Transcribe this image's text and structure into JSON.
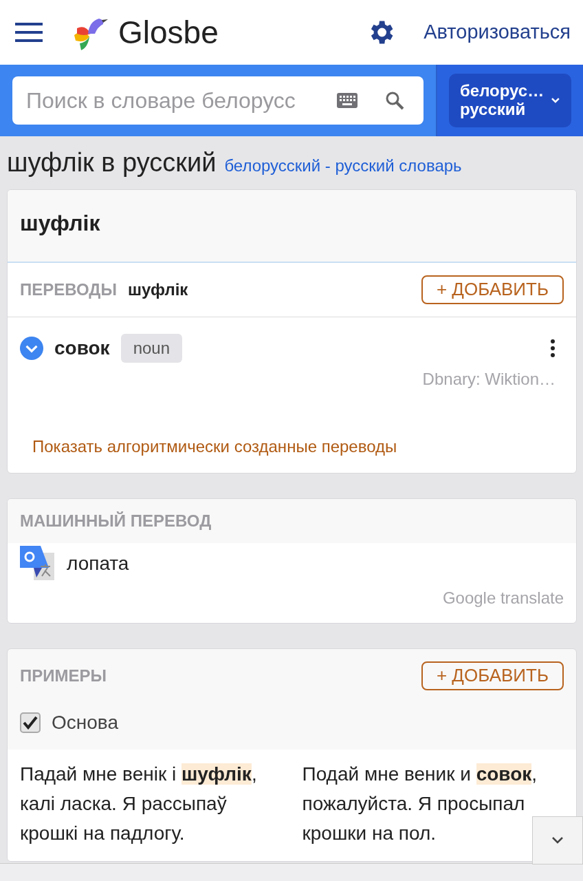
{
  "header": {
    "logo_text": "Glosbe",
    "login_link": "Авторизоваться"
  },
  "search": {
    "placeholder": "Поиск в словаре белорусс",
    "language_pair": [
      "белорус…",
      "русский"
    ]
  },
  "page_title": {
    "word": "шуфлік в русский",
    "dictionary_link": "белорусский - русский словарь"
  },
  "entry": {
    "headword": "шуфлік",
    "translations_label": "ПЕРЕВОДЫ",
    "translations_word": "шуфлік",
    "add_button": "+ ДОБАВИТЬ",
    "translations": [
      {
        "word": "совок",
        "pos": "noun",
        "expanded": false,
        "source": "Dbnary: Wiktion…"
      }
    ],
    "show_more_link": "Показать алгоритмически созданные переводы"
  },
  "machine_translation": {
    "label": "МАШИННЫЙ ПЕРЕВОД",
    "text": "лопата",
    "source": "Google translate"
  },
  "examples": {
    "label": "ПРИМЕРЫ",
    "add_button": "+ ДОБАВИТЬ",
    "filter": {
      "label": "Основа",
      "checked": true
    },
    "items": [
      {
        "source": "Падай мне венік і **шуфлік**, калі ласка. Я рассыпаў крошкі на падлогу.",
        "target": "Подай мне веник и **совок**, пожалуйста. Я просыпал крошки на пол."
      }
    ]
  }
}
